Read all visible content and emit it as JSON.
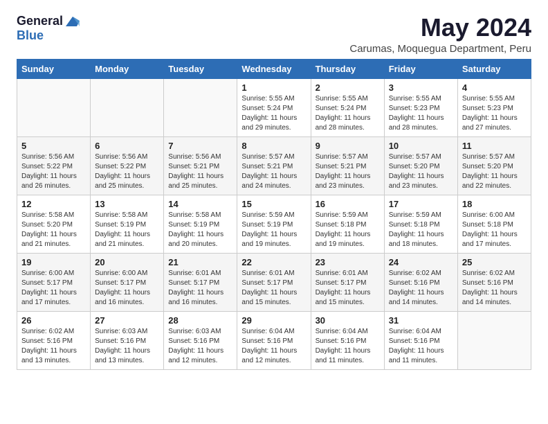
{
  "header": {
    "logo_general": "General",
    "logo_blue": "Blue",
    "title": "May 2024",
    "location": "Carumas, Moquegua Department, Peru"
  },
  "weekdays": [
    "Sunday",
    "Monday",
    "Tuesday",
    "Wednesday",
    "Thursday",
    "Friday",
    "Saturday"
  ],
  "weeks": [
    [
      {
        "day": "",
        "info": ""
      },
      {
        "day": "",
        "info": ""
      },
      {
        "day": "",
        "info": ""
      },
      {
        "day": "1",
        "info": "Sunrise: 5:55 AM\nSunset: 5:24 PM\nDaylight: 11 hours and 29 minutes."
      },
      {
        "day": "2",
        "info": "Sunrise: 5:55 AM\nSunset: 5:24 PM\nDaylight: 11 hours and 28 minutes."
      },
      {
        "day": "3",
        "info": "Sunrise: 5:55 AM\nSunset: 5:23 PM\nDaylight: 11 hours and 28 minutes."
      },
      {
        "day": "4",
        "info": "Sunrise: 5:55 AM\nSunset: 5:23 PM\nDaylight: 11 hours and 27 minutes."
      }
    ],
    [
      {
        "day": "5",
        "info": "Sunrise: 5:56 AM\nSunset: 5:22 PM\nDaylight: 11 hours and 26 minutes."
      },
      {
        "day": "6",
        "info": "Sunrise: 5:56 AM\nSunset: 5:22 PM\nDaylight: 11 hours and 25 minutes."
      },
      {
        "day": "7",
        "info": "Sunrise: 5:56 AM\nSunset: 5:21 PM\nDaylight: 11 hours and 25 minutes."
      },
      {
        "day": "8",
        "info": "Sunrise: 5:57 AM\nSunset: 5:21 PM\nDaylight: 11 hours and 24 minutes."
      },
      {
        "day": "9",
        "info": "Sunrise: 5:57 AM\nSunset: 5:21 PM\nDaylight: 11 hours and 23 minutes."
      },
      {
        "day": "10",
        "info": "Sunrise: 5:57 AM\nSunset: 5:20 PM\nDaylight: 11 hours and 23 minutes."
      },
      {
        "day": "11",
        "info": "Sunrise: 5:57 AM\nSunset: 5:20 PM\nDaylight: 11 hours and 22 minutes."
      }
    ],
    [
      {
        "day": "12",
        "info": "Sunrise: 5:58 AM\nSunset: 5:20 PM\nDaylight: 11 hours and 21 minutes."
      },
      {
        "day": "13",
        "info": "Sunrise: 5:58 AM\nSunset: 5:19 PM\nDaylight: 11 hours and 21 minutes."
      },
      {
        "day": "14",
        "info": "Sunrise: 5:58 AM\nSunset: 5:19 PM\nDaylight: 11 hours and 20 minutes."
      },
      {
        "day": "15",
        "info": "Sunrise: 5:59 AM\nSunset: 5:19 PM\nDaylight: 11 hours and 19 minutes."
      },
      {
        "day": "16",
        "info": "Sunrise: 5:59 AM\nSunset: 5:18 PM\nDaylight: 11 hours and 19 minutes."
      },
      {
        "day": "17",
        "info": "Sunrise: 5:59 AM\nSunset: 5:18 PM\nDaylight: 11 hours and 18 minutes."
      },
      {
        "day": "18",
        "info": "Sunrise: 6:00 AM\nSunset: 5:18 PM\nDaylight: 11 hours and 17 minutes."
      }
    ],
    [
      {
        "day": "19",
        "info": "Sunrise: 6:00 AM\nSunset: 5:17 PM\nDaylight: 11 hours and 17 minutes."
      },
      {
        "day": "20",
        "info": "Sunrise: 6:00 AM\nSunset: 5:17 PM\nDaylight: 11 hours and 16 minutes."
      },
      {
        "day": "21",
        "info": "Sunrise: 6:01 AM\nSunset: 5:17 PM\nDaylight: 11 hours and 16 minutes."
      },
      {
        "day": "22",
        "info": "Sunrise: 6:01 AM\nSunset: 5:17 PM\nDaylight: 11 hours and 15 minutes."
      },
      {
        "day": "23",
        "info": "Sunrise: 6:01 AM\nSunset: 5:17 PM\nDaylight: 11 hours and 15 minutes."
      },
      {
        "day": "24",
        "info": "Sunrise: 6:02 AM\nSunset: 5:16 PM\nDaylight: 11 hours and 14 minutes."
      },
      {
        "day": "25",
        "info": "Sunrise: 6:02 AM\nSunset: 5:16 PM\nDaylight: 11 hours and 14 minutes."
      }
    ],
    [
      {
        "day": "26",
        "info": "Sunrise: 6:02 AM\nSunset: 5:16 PM\nDaylight: 11 hours and 13 minutes."
      },
      {
        "day": "27",
        "info": "Sunrise: 6:03 AM\nSunset: 5:16 PM\nDaylight: 11 hours and 13 minutes."
      },
      {
        "day": "28",
        "info": "Sunrise: 6:03 AM\nSunset: 5:16 PM\nDaylight: 11 hours and 12 minutes."
      },
      {
        "day": "29",
        "info": "Sunrise: 6:04 AM\nSunset: 5:16 PM\nDaylight: 11 hours and 12 minutes."
      },
      {
        "day": "30",
        "info": "Sunrise: 6:04 AM\nSunset: 5:16 PM\nDaylight: 11 hours and 11 minutes."
      },
      {
        "day": "31",
        "info": "Sunrise: 6:04 AM\nSunset: 5:16 PM\nDaylight: 11 hours and 11 minutes."
      },
      {
        "day": "",
        "info": ""
      }
    ]
  ]
}
